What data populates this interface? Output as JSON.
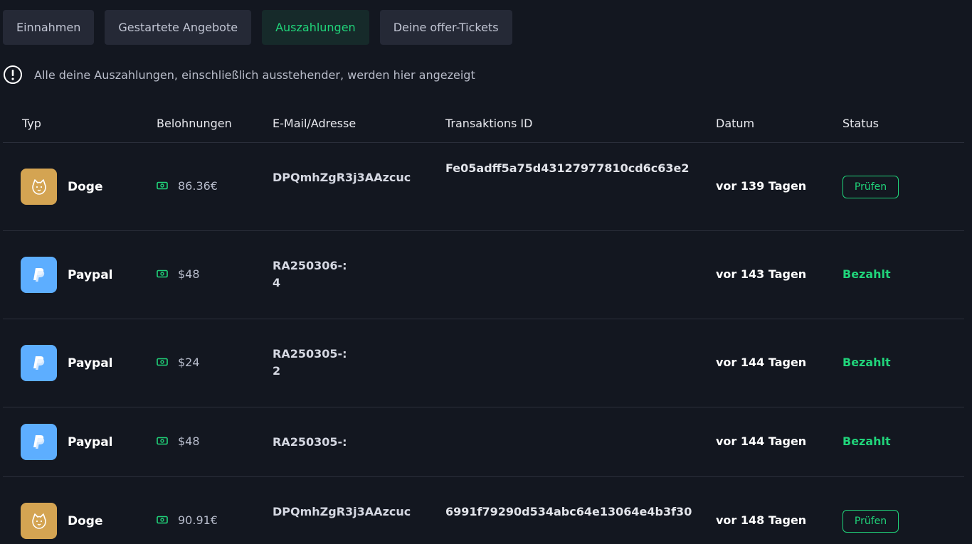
{
  "tabs": [
    {
      "label": "Einnahmen",
      "active": false
    },
    {
      "label": "Gestartete Angebote",
      "active": false
    },
    {
      "label": "Auszahlungen",
      "active": true
    },
    {
      "label": "Deine offer-Tickets",
      "active": false
    }
  ],
  "info": {
    "text": "Alle deine Auszahlungen, einschließlich ausstehender, werden hier angezeigt",
    "icon": "exclamation-circle-icon"
  },
  "table": {
    "headers": {
      "type": "Typ",
      "rewards": "Belohnungen",
      "address": "E-Mail/Adresse",
      "transaction": "Transaktions ID",
      "date": "Datum",
      "status": "Status"
    },
    "rows": [
      {
        "type": "Doge",
        "icon": "doge-icon",
        "reward": "86.36€",
        "address": "DPQmhZgR3j3AAzcuc",
        "address2": "",
        "transaction": "Fe05adff5a75d43127977810cd6c63e2",
        "date": "vor 139 Tagen",
        "status": "Prüfen",
        "status_kind": "button"
      },
      {
        "type": "Paypal",
        "icon": "paypal-icon",
        "reward": "$48",
        "address": "RA250306-:",
        "address2": "4",
        "transaction": "",
        "date": "vor 143 Tagen",
        "status": "Bezahlt",
        "status_kind": "text"
      },
      {
        "type": "Paypal",
        "icon": "paypal-icon",
        "reward": "$24",
        "address": "RA250305-:",
        "address2": "2",
        "transaction": "",
        "date": "vor 144 Tagen",
        "status": "Bezahlt",
        "status_kind": "text"
      },
      {
        "type": "Paypal",
        "icon": "paypal-icon",
        "reward": "$48",
        "address": "RA250305-:",
        "address2": "",
        "transaction": "",
        "date": "vor 144 Tagen",
        "status": "Bezahlt",
        "status_kind": "text"
      },
      {
        "type": "Doge",
        "icon": "doge-icon",
        "reward": "90.91€",
        "address": "DPQmhZgR3j3AAzcuc",
        "address2": "",
        "transaction": "6991f79290d534abc64e13064e4b3f30",
        "date": "vor 148 Tagen",
        "status": "Prüfen",
        "status_kind": "button"
      }
    ]
  },
  "colors": {
    "background": "#131720",
    "tab_bg": "#252936",
    "tab_active_bg": "#162a2a",
    "accent_green": "#20d47a",
    "doge_gold": "#d4a452",
    "paypal_blue": "#5daeff"
  }
}
